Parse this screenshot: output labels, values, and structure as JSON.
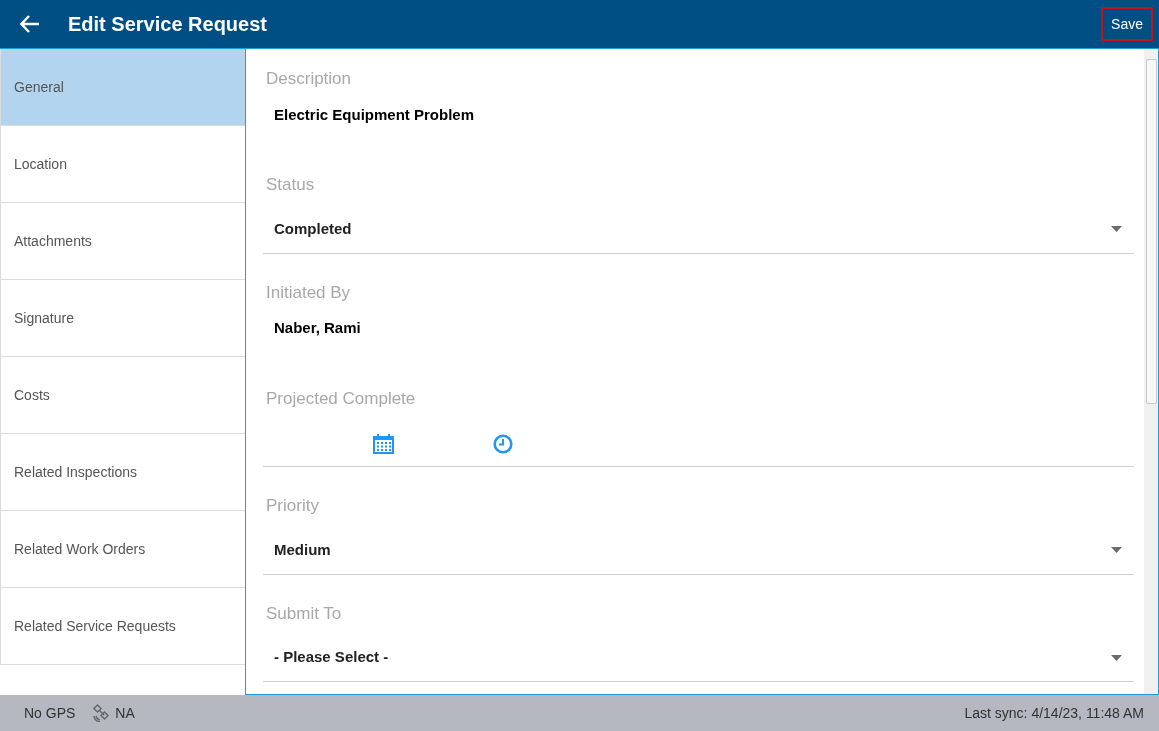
{
  "header": {
    "title": "Edit Service Request",
    "save_label": "Save"
  },
  "sidebar": {
    "items": [
      {
        "label": "General",
        "selected": true
      },
      {
        "label": "Location",
        "selected": false
      },
      {
        "label": "Attachments",
        "selected": false
      },
      {
        "label": "Signature",
        "selected": false
      },
      {
        "label": "Costs",
        "selected": false
      },
      {
        "label": "Related Inspections",
        "selected": false
      },
      {
        "label": "Related Work Orders",
        "selected": false
      },
      {
        "label": "Related Service Requests",
        "selected": false
      }
    ]
  },
  "fields": [
    {
      "kind": "text",
      "label": "Description",
      "value": "Electric Equipment Problem"
    },
    {
      "kind": "select",
      "label": "Status",
      "value": "Completed"
    },
    {
      "kind": "text",
      "label": "Initiated By",
      "value": "Naber, Rami"
    },
    {
      "kind": "datetime",
      "label": "Projected Complete"
    },
    {
      "kind": "select",
      "label": "Priority",
      "value": "Medium"
    },
    {
      "kind": "select",
      "label": "Submit To",
      "value": "- Please Select -"
    }
  ],
  "status_bar": {
    "gps": "No GPS",
    "signal": "NA",
    "last_sync": "Last sync: 4/14/23, 11:48 AM"
  }
}
